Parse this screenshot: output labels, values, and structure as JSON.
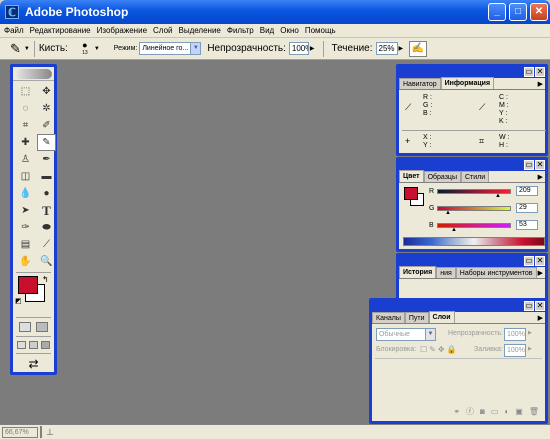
{
  "window": {
    "title": "Adobe Photoshop",
    "logo": "photoshop-logo-icon",
    "controls": [
      "_",
      "□",
      "✕"
    ]
  },
  "menu": {
    "items": [
      "Файл",
      "Редактирование",
      "Изображение",
      "Слой",
      "Выделение",
      "Фильтр",
      "Вид",
      "Окно",
      "Помощь"
    ]
  },
  "options": {
    "brush_label": "Кисть:",
    "brush_size": "13",
    "mode_label": "Режим:",
    "mode_value": "Линейное го...",
    "opacity_label": "Непрозрачность:",
    "opacity_value": "100%",
    "flow_label": "Течение:",
    "flow_value": "25%"
  },
  "toolbox": {
    "foreground_color": "#c8102e",
    "background_color": "#ffffff",
    "tools": [
      "marquee",
      "move",
      "lasso",
      "magic-wand",
      "crop",
      "slice",
      "healing",
      "brush",
      "stamp",
      "history-brush",
      "eraser",
      "gradient",
      "blur",
      "dodge",
      "path-select",
      "type",
      "pen",
      "shape",
      "notes",
      "eyedropper",
      "hand",
      "zoom"
    ],
    "type_glyph": "T"
  },
  "navigator": {
    "tabs": [
      "Навигатор",
      "Информация"
    ],
    "rgb_labels": [
      "R :",
      "G :",
      "B :"
    ],
    "cmyk_labels": [
      "C :",
      "M :",
      "Y :",
      "K :"
    ],
    "xy_labels": [
      "X :",
      "Y :"
    ],
    "wh_labels": [
      "W :",
      "H :"
    ]
  },
  "color": {
    "tabs": [
      "Цвет",
      "Образцы",
      "Стили"
    ],
    "swatch_color": "#c8102e",
    "r_label": "R",
    "r_value": "209",
    "g_label": "G",
    "g_value": "29",
    "b_label": "B",
    "b_value": "53",
    "r": 209,
    "g": 29,
    "b": 53
  },
  "history": {
    "tabs": [
      "История",
      "Операции",
      "Наборы инструментов"
    ],
    "visible_tab_labels": [
      "История",
      "ния",
      "Наборы инструментов"
    ]
  },
  "layers": {
    "tabs": [
      "Каналы",
      "Пути",
      "Слои"
    ],
    "blend_mode": "Обычные",
    "opacity_label": "Непрозрачность:",
    "opacity_value": "100%",
    "lock_label": "Блокировка:",
    "fill_label": "Заливка:",
    "fill_value": "100%"
  },
  "status": {
    "zoom": "66,67%"
  }
}
